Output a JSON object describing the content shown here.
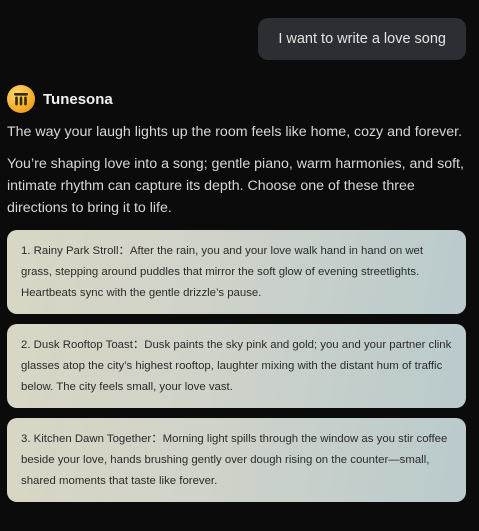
{
  "user_message": "I want to write a love song",
  "bot": {
    "name": "Tunesona",
    "avatar_icon": "tunesona-logo-icon",
    "avatar_color": "#f2a51f"
  },
  "response": {
    "line1": "The way your laugh lights up the room feels like home, cozy and forever.",
    "line2": "You’re shaping love into a song; gentle piano, warm harmonies, and soft, intimate rhythm can capture its depth. Choose one of these three directions to bring it to life."
  },
  "options": [
    {
      "text": "1. Rainy Park Stroll：After the rain, you and your love walk hand in hand on wet grass, stepping around puddles that mirror the soft glow of evening streetlights. Heartbeats sync with the gentle drizzle’s pause."
    },
    {
      "text": "2. Dusk Rooftop Toast：Dusk paints the sky pink and gold; you and your partner clink glasses atop the city’s highest rooftop, laughter mixing with the distant hum of traffic below. The city feels small, your love vast."
    },
    {
      "text": "3. Kitchen Dawn Together：Morning light spills through the window as you stir coffee beside your love, hands brushing gently over dough rising on the counter—small, shared moments that taste like forever."
    }
  ]
}
